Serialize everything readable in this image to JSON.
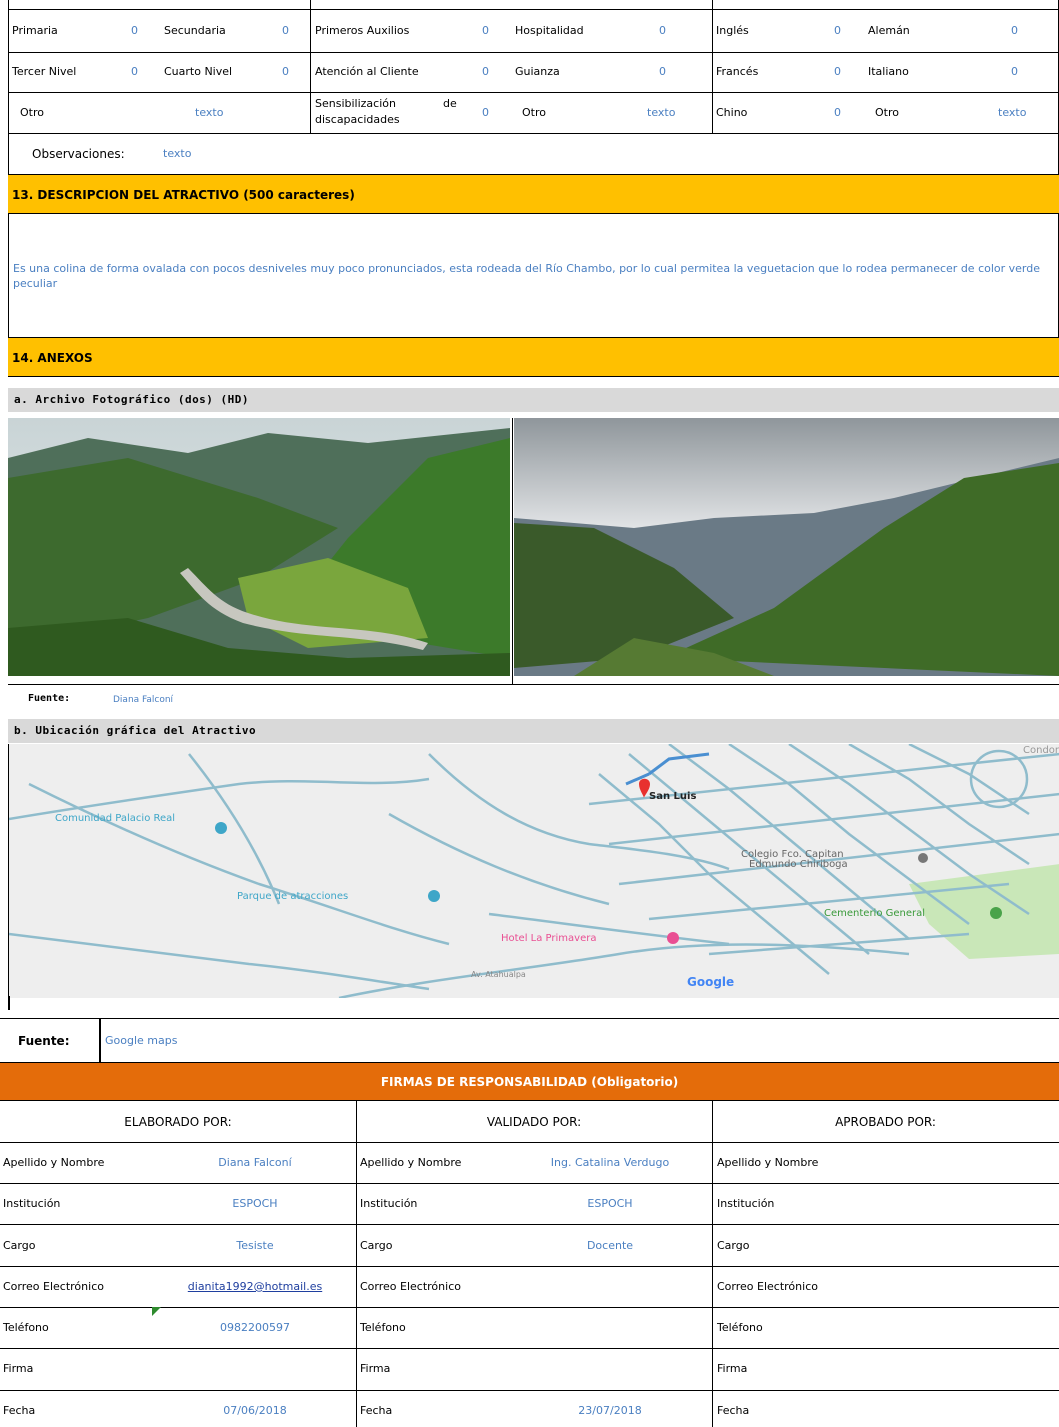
{
  "top_table": {
    "row1": [
      {
        "label": "Primaria",
        "value": "0"
      },
      {
        "label": "Secundaria",
        "value": "0"
      },
      {
        "label": "Primeros Auxilios",
        "value": "0"
      },
      {
        "label": "Hospitalidad",
        "value": "0"
      },
      {
        "label": "Inglés",
        "value": "0"
      },
      {
        "label": "Alemán",
        "value": "0"
      }
    ],
    "row2": [
      {
        "label": "Tercer Nivel",
        "value": "0"
      },
      {
        "label": "Cuarto Nivel",
        "value": "0"
      },
      {
        "label": "Atención al Cliente",
        "value": "0"
      },
      {
        "label": "Guianza",
        "value": "0"
      },
      {
        "label": "Francés",
        "value": "0"
      },
      {
        "label": "Italiano",
        "value": "0"
      }
    ],
    "row3": {
      "otro1_label": "Otro",
      "otro1_value": "texto",
      "sens_label_a": "Sensibilización",
      "sens_label_b": "de",
      "sens_label_c": "discapacidades",
      "sens_value": "0",
      "otro2_label": "Otro",
      "otro2_value": "texto",
      "chino_label": "Chino",
      "chino_value": "0",
      "otro3_label": "Otro",
      "otro3_value": "texto"
    },
    "obs_label": "Observaciones:",
    "obs_value": "texto"
  },
  "section13": {
    "title": "13. DESCRIPCION DEL ATRACTIVO (500 caracteres)",
    "text": "Es una colina de forma ovalada con pocos desniveles muy poco pronunciados, esta rodeada del Río Chambo, por lo cual permitea la veguetacion que lo rodea permanecer de color verde peculiar"
  },
  "section14": {
    "title": "14. ANEXOS",
    "photos_title": "a. Archivo Fotográfico (dos) (HD)",
    "photos_source_label": "Fuente:",
    "photos_source_value": "Diana Falconí",
    "map_title": "b. Ubicación gráfica del Atractivo",
    "map_source_label": "Fuente:",
    "map_source_value": "Google maps",
    "map_labels": {
      "comunidad": "Comunidad Palacio Real",
      "parque": "Parque de atracciones",
      "hotel": "Hotel La Primavera",
      "sanluis": "San Luis",
      "colegio_a": "Colegio Fco. Capitan",
      "colegio_b": "Edmundo Chiriboga",
      "cementerio": "Cementerio General",
      "av": "Av. Atahualpa",
      "condor": "Condor",
      "google": "Google"
    }
  },
  "signatures": {
    "title": "FIRMAS DE RESPONSABILIDAD (Obligatorio)",
    "columns": [
      {
        "head": "ELABORADO POR:"
      },
      {
        "head": "VALIDADO POR:"
      },
      {
        "head": "APROBADO POR:"
      }
    ],
    "row_labels": [
      "Apellido y Nombre",
      "Institución",
      "Cargo",
      "Correo Electrónico",
      "Teléfono",
      "Firma",
      "Fecha"
    ],
    "col1_values": [
      "Diana Falconí",
      "ESPOCH",
      "Tesiste",
      "dianita1992@hotmail.es",
      "0982200597",
      "",
      "07/06/2018"
    ],
    "col2_values": [
      "Ing. Catalina Verdugo",
      "ESPOCH",
      "Docente",
      "",
      "",
      "",
      "23/07/2018"
    ]
  },
  "colors": {
    "section_yellow": "#ffc000",
    "signature_orange": "#e46c0a",
    "value_blue": "#4a7fc1",
    "subheader_gray": "#d9d9d9"
  }
}
